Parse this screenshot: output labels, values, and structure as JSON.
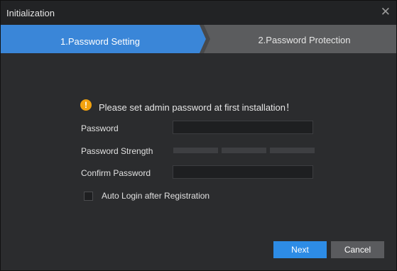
{
  "window": {
    "title": "Initialization",
    "close_symbol": "✕"
  },
  "steps": [
    {
      "label": "1.Password Setting",
      "active": true
    },
    {
      "label": "2.Password Protection",
      "active": false
    }
  ],
  "notice": {
    "icon": "warning-icon",
    "icon_glyph": "!",
    "text": "Please set admin password at first installation！"
  },
  "form": {
    "password_label": "Password",
    "password_value": "",
    "strength_label": "Password Strength",
    "strength_level": 0,
    "confirm_label": "Confirm Password",
    "confirm_value": "",
    "auto_login_label": "Auto Login after Registration",
    "auto_login_checked": false
  },
  "buttons": {
    "next_label": "Next",
    "cancel_label": "Cancel"
  },
  "colors": {
    "accent": "#2d8ce6",
    "step_active": "#3a86d8",
    "warning": "#f2a20f"
  }
}
